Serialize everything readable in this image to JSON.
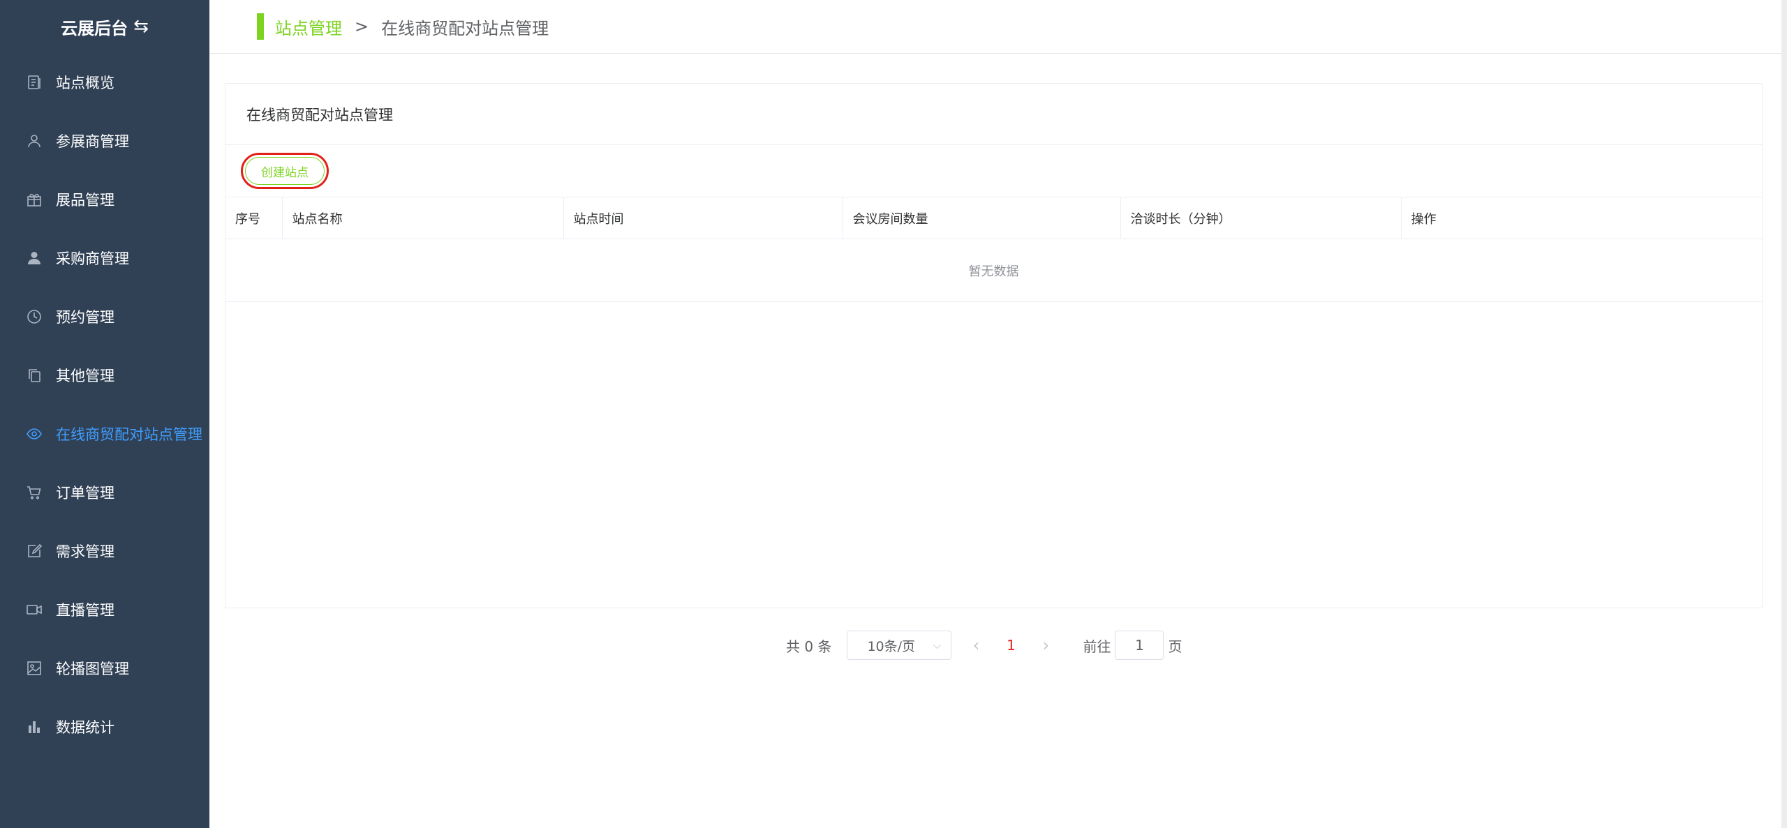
{
  "brand": {
    "title": "云展后台",
    "swap_glyph": "⇆"
  },
  "sidebar": {
    "items": [
      {
        "label": "站点概览",
        "icon": "document-icon"
      },
      {
        "label": "参展商管理",
        "icon": "user-outline-icon"
      },
      {
        "label": "展品管理",
        "icon": "gift-icon"
      },
      {
        "label": "采购商管理",
        "icon": "user-filled-icon"
      },
      {
        "label": "预约管理",
        "icon": "clock-icon"
      },
      {
        "label": "其他管理",
        "icon": "copy-icon"
      },
      {
        "label": "在线商贸配对站点管理",
        "icon": "eye-icon",
        "active": true
      },
      {
        "label": "订单管理",
        "icon": "cart-icon"
      },
      {
        "label": "需求管理",
        "icon": "edit-icon"
      },
      {
        "label": "直播管理",
        "icon": "video-camera-icon"
      },
      {
        "label": "轮播图管理",
        "icon": "picture-icon"
      },
      {
        "label": "数据统计",
        "icon": "bar-chart-icon"
      }
    ]
  },
  "header": {
    "breadcrumb": {
      "root": "站点管理",
      "separator": ">",
      "current": "在线商贸配对站点管理"
    }
  },
  "card": {
    "title": "在线商贸配对站点管理",
    "create_label": "创建站点",
    "columns": [
      "序号",
      "站点名称",
      "站点时间",
      "会议房间数量",
      "洽谈时长（分钟）",
      "操作"
    ],
    "empty_text": "暂无数据"
  },
  "pagination": {
    "total_text": "共 0 条",
    "page_size": "10条/页",
    "current_page": "1",
    "goto_label": "前往",
    "goto_value": "1",
    "page_suffix": "页"
  },
  "colors": {
    "sidebar_bg": "#304156",
    "accent_green": "#7ed321",
    "active_blue": "#409eff",
    "highlight_red": "#e32119"
  }
}
